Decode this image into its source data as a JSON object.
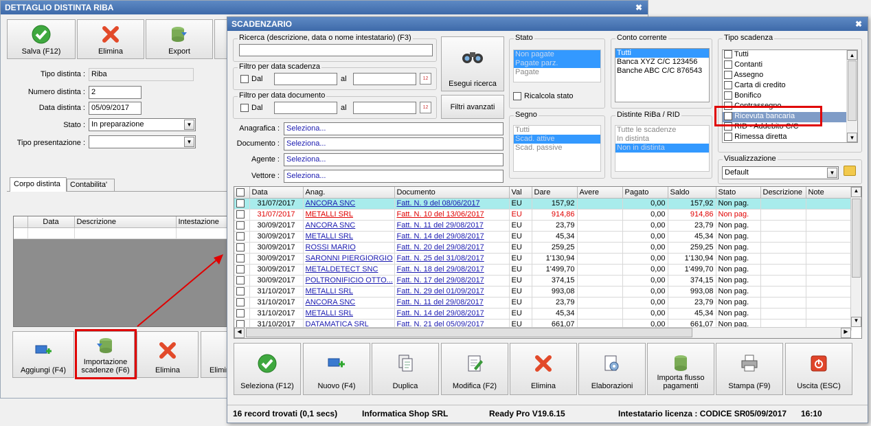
{
  "back_window": {
    "title": "DETTAGLIO DISTINTA RIBA",
    "toolbar": {
      "save": "Salva (F12)",
      "delete": "Elimina",
      "export": "Export"
    },
    "fields": {
      "tipo_label": "Tipo distinta :",
      "tipo_value": "Riba",
      "numero_label": "Numero distinta :",
      "numero_value": "2",
      "data_label": "Data distinta :",
      "data_value": "05/09/2017",
      "stato_label": "Stato :",
      "stato_value": "In preparazione",
      "presentazione_label": "Tipo presentazione :",
      "presentazione_value": ""
    },
    "tabs": [
      "Corpo distinta",
      "Contabilita'"
    ],
    "grid_headers": [
      "Data",
      "Descrizione",
      "Intestazione"
    ],
    "bottom": {
      "add": "Aggiungi (F4)",
      "import": "Importazione scadenze (F6)",
      "delete": "Elimina",
      "delete2": "Elimin"
    }
  },
  "front_window": {
    "title": "SCADENZARIO",
    "search": {
      "label": "Ricerca (descrizione, data o nome intestatario) (F3)",
      "value": "",
      "exec_button": "Esegui ricerca",
      "advanced_button": "Filtri avanzati"
    },
    "filter_scadenza": {
      "label": "Filtro per data scadenza",
      "dal": "Dal",
      "al": "al"
    },
    "filter_documento": {
      "label": "Filtro per data documento",
      "dal": "Dal",
      "al": "al"
    },
    "lookups": [
      {
        "label": "Anagrafica :",
        "value": "Seleziona..."
      },
      {
        "label": "Documento :",
        "value": "Seleziona..."
      },
      {
        "label": "Agente :",
        "value": "Seleziona..."
      },
      {
        "label": "Vettore :",
        "value": "Seleziona..."
      }
    ],
    "stato": {
      "label": "Stato",
      "items": [
        "Non pagate",
        "Pagate parz.",
        "Pagate"
      ],
      "ricalcola": "Ricalcola stato"
    },
    "conto": {
      "label": "Conto corrente",
      "items": [
        "Tutti",
        "Banca XYZ C/C 123456",
        "Banche ABC C/C 876543"
      ]
    },
    "segno": {
      "label": "Segno",
      "items": [
        "Tutti",
        "Scad. attive",
        "Scad. passive"
      ]
    },
    "distinte": {
      "label": "Distinte RiBa / RID",
      "items": [
        "Tutte le scadenze",
        "In distinta",
        "Non in distinta"
      ]
    },
    "tipo_scadenza": {
      "label": "Tipo scadenza",
      "items": [
        "Tutti",
        "Contanti",
        "Assegno",
        "Carta di credito",
        "Bonifico",
        "Contrassegno",
        "Ricevuta bancaria",
        "RID - Addebito C/C",
        "Rimessa diretta"
      ]
    },
    "visualizzazione": {
      "label": "Visualizzazione",
      "value": "Default"
    },
    "grid": {
      "headers": [
        "Data",
        "Anag.",
        "Documento",
        "Val",
        "Dare",
        "Avere",
        "Pagato",
        "Saldo",
        "Stato",
        "Descrizione",
        "Note"
      ],
      "rows": [
        [
          "31/07/2017",
          "ANCORA SNC",
          "Fatt. N. 9 del 08/06/2017",
          "EU",
          "157,92",
          "",
          "0,00",
          "157,92",
          "Non pag."
        ],
        [
          "31/07/2017",
          "METALLI SRL",
          "Fatt. N. 10 del 13/06/2017",
          "EU",
          "914,86",
          "",
          "0,00",
          "914,86",
          "Non pag."
        ],
        [
          "30/09/2017",
          "ANCORA SNC",
          "Fatt. N. 11 del 29/08/2017",
          "EU",
          "23,79",
          "",
          "0,00",
          "23,79",
          "Non pag."
        ],
        [
          "30/09/2017",
          "METALLI SRL",
          "Fatt. N. 14 del 29/08/2017",
          "EU",
          "45,34",
          "",
          "0,00",
          "45,34",
          "Non pag."
        ],
        [
          "30/09/2017",
          "ROSSI MARIO",
          "Fatt. N. 20 del 29/08/2017",
          "EU",
          "259,25",
          "",
          "0,00",
          "259,25",
          "Non pag."
        ],
        [
          "30/09/2017",
          "SARONNI PIERGIORGIO",
          "Fatt. N. 25 del 31/08/2017",
          "EU",
          "1'130,94",
          "",
          "0,00",
          "1'130,94",
          "Non pag."
        ],
        [
          "30/09/2017",
          "METALDETECT SNC",
          "Fatt. N. 18 del 29/08/2017",
          "EU",
          "1'499,70",
          "",
          "0,00",
          "1'499,70",
          "Non pag."
        ],
        [
          "30/09/2017",
          "POLTRONIFICIO OTTO...",
          "Fatt. N. 17 del 29/08/2017",
          "EU",
          "374,15",
          "",
          "0,00",
          "374,15",
          "Non pag."
        ],
        [
          "31/10/2017",
          "METALLI SRL",
          "Fatt. N. 29 del 01/09/2017",
          "EU",
          "993,08",
          "",
          "0,00",
          "993,08",
          "Non pag."
        ],
        [
          "31/10/2017",
          "ANCORA SNC",
          "Fatt. N. 11 del 29/08/2017",
          "EU",
          "23,79",
          "",
          "0,00",
          "23,79",
          "Non pag."
        ],
        [
          "31/10/2017",
          "METALLI SRL",
          "Fatt. N. 14 del 29/08/2017",
          "EU",
          "45,34",
          "",
          "0,00",
          "45,34",
          "Non pag."
        ],
        [
          "31/10/2017",
          "DATAMATICA SRL",
          "Fatt. N. 21 del 05/09/2017",
          "EU",
          "661,07",
          "",
          "0,00",
          "661,07",
          "Non pag."
        ]
      ]
    },
    "actions": [
      "Seleziona (F12)",
      "Nuovo (F4)",
      "Duplica",
      "Modifica (F2)",
      "Elimina",
      "Elaborazioni",
      "Importa flusso pagamenti",
      "Stampa (F9)",
      "Uscita (ESC)"
    ],
    "status": {
      "records": "16 record trovati (0,1 secs)",
      "company": "Informatica Shop SRL",
      "version": "Ready Pro V19.6.15",
      "license": "Intestatario licenza : CODICE SR",
      "date": "05/09/2017",
      "time": "16:10"
    }
  },
  "colors": {
    "title": "#3e6aa9",
    "selection": "#3399ff",
    "highlight_row": "#a8ecec",
    "annotation": "#e00000"
  }
}
